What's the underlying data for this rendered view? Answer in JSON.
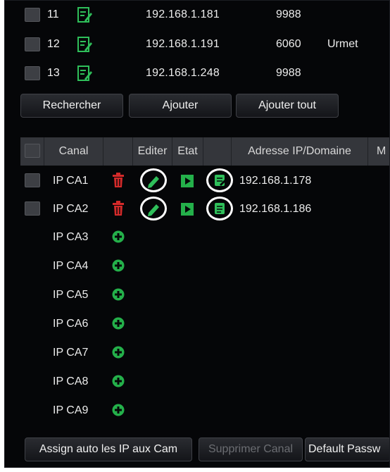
{
  "device_list": [
    {
      "num": "11",
      "ip": "192.168.1.181",
      "port": "9988",
      "brand": ""
    },
    {
      "num": "12",
      "ip": "192.168.1.191",
      "port": "6060",
      "brand": "Urmet"
    },
    {
      "num": "13",
      "ip": "192.168.1.248",
      "port": "9988",
      "brand": ""
    }
  ],
  "device_buttons": {
    "search": "Rechercher",
    "add": "Ajouter",
    "add_all": "Ajouter tout"
  },
  "channel_table": {
    "headers": {
      "channel": "Canal",
      "edit": "Editer",
      "state": "Etat",
      "address": "Adresse IP/Domaine",
      "more": "M"
    },
    "rows": [
      {
        "name": "IP CA1",
        "ip": "192.168.1.178",
        "assigned": true
      },
      {
        "name": "IP CA2",
        "ip": "192.168.1.186",
        "assigned": true
      },
      {
        "name": "IP CA3",
        "assigned": false
      },
      {
        "name": "IP CA4",
        "assigned": false
      },
      {
        "name": "IP CA5",
        "assigned": false
      },
      {
        "name": "IP CA6",
        "assigned": false
      },
      {
        "name": "IP CA7",
        "assigned": false
      },
      {
        "name": "IP CA8",
        "assigned": false
      },
      {
        "name": "IP CA9",
        "assigned": false
      }
    ]
  },
  "bottom_buttons": {
    "assign_auto": "Assign auto les IP aux Cam",
    "delete_channel": "Supprimer Canal",
    "default_password": "Default Passw"
  },
  "colors": {
    "background": "#050608",
    "header": "#34363b",
    "accent_green": "#24b04a",
    "delete_red": "#d42a2a"
  },
  "icons": {
    "note": "edit-note-icon",
    "trash": "trash-icon",
    "plus": "add-circle-icon",
    "pencil": "pencil-icon",
    "play": "play-icon",
    "doc": "document-icon"
  }
}
